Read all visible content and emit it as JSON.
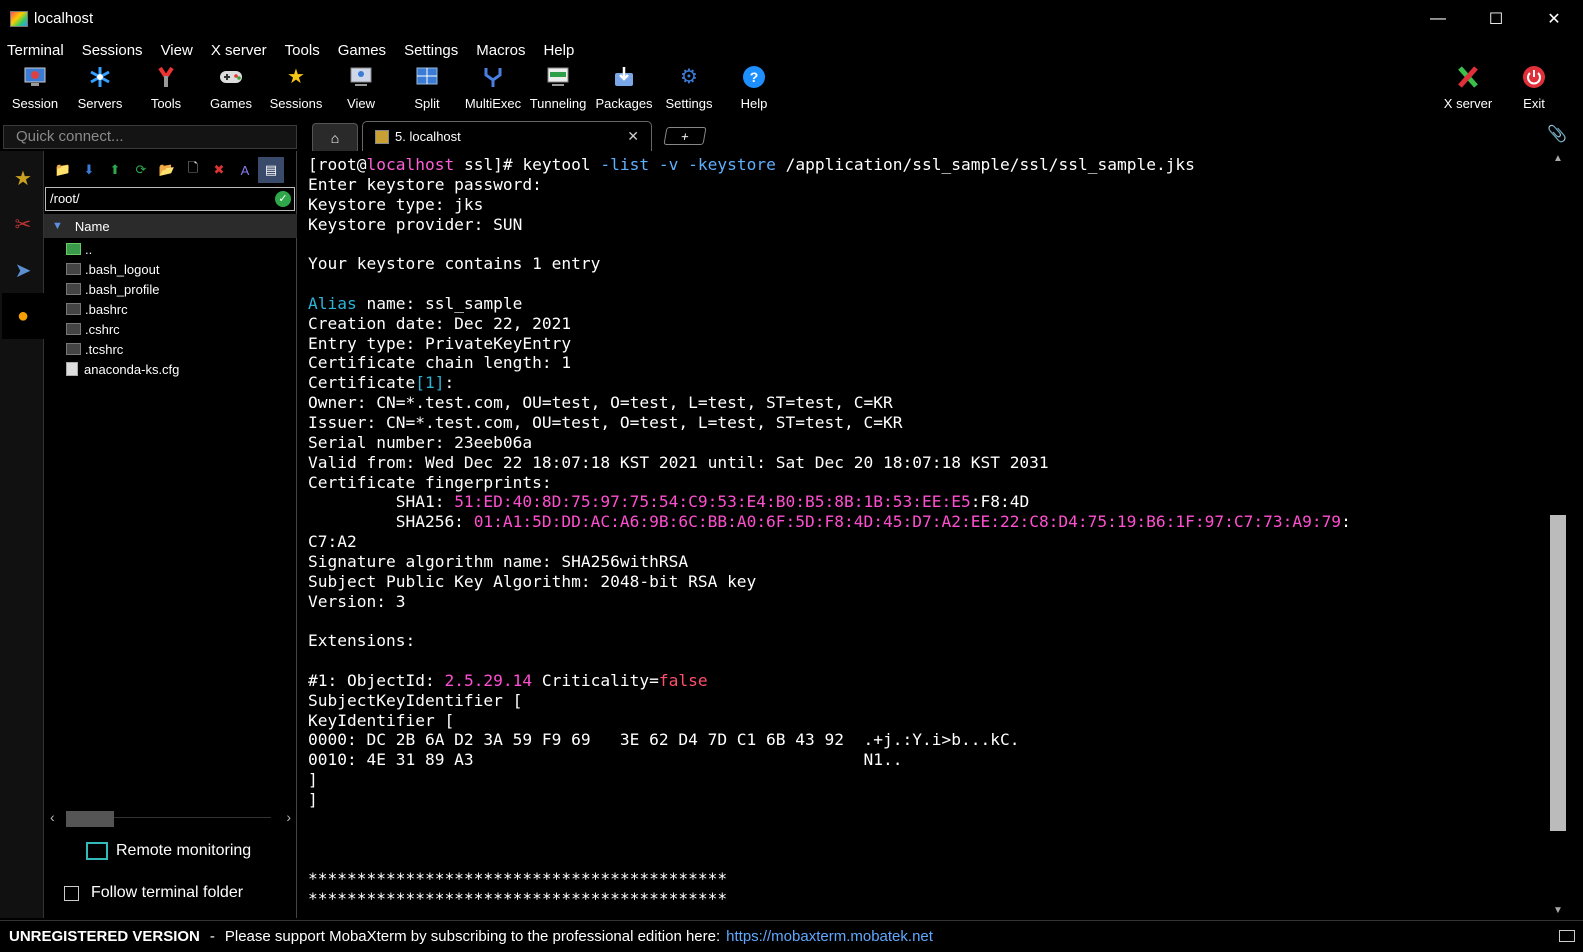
{
  "window": {
    "title": "localhost",
    "minimize": "—",
    "maximize": "☐",
    "close": "✕"
  },
  "menu": [
    "Terminal",
    "Sessions",
    "View",
    "X server",
    "Tools",
    "Games",
    "Settings",
    "Macros",
    "Help"
  ],
  "toolbar": {
    "session": "Session",
    "servers": "Servers",
    "tools": "Tools",
    "games": "Games",
    "sessions": "Sessions",
    "view": "View",
    "split": "Split",
    "multiexec": "MultiExec",
    "tunneling": "Tunneling",
    "packages": "Packages",
    "settings": "Settings",
    "help": "Help",
    "xserver": "X server",
    "exit": "Exit"
  },
  "quick_connect": {
    "placeholder": "Quick connect..."
  },
  "tabs": {
    "active_label": "5. localhost",
    "close": "✕",
    "add": "+"
  },
  "sidebar": {
    "path": "/root/",
    "column_header": "Name",
    "files": [
      "..",
      ".bash_logout",
      ".bash_profile",
      ".bashrc",
      ".cshrc",
      ".tcshrc",
      "anaconda-ks.cfg"
    ],
    "remote_monitoring": "Remote monitoring",
    "follow_terminal_folder": "Follow terminal folder"
  },
  "terminal": {
    "prompt_open": "[root@",
    "prompt_host": "localhost",
    "prompt_close": " ssl]# ",
    "cmd_keytool": "keytool ",
    "cmd_opt_list": "-list",
    "cmd_sp1": " ",
    "cmd_opt_v": "-v",
    "cmd_sp2": " ",
    "cmd_opt_keystore": "-keystore",
    "cmd_path": " /application/ssl_sample/ssl/ssl_sample.jks",
    "l_enter_pw": "Enter keystore password:",
    "l_ks_type": "Keystore type: jks",
    "l_ks_provider": "Keystore provider: SUN",
    "l_contains": "Your keystore contains 1 entry",
    "alias_word": "Alias",
    "alias_rest": " name: ssl_sample",
    "l_creation": "Creation date: Dec 22, 2021",
    "l_entry_type": "Entry type: PrivateKeyEntry",
    "l_chain": "Certificate chain length: 1",
    "cert_word": "Certificate",
    "cert_idx": "[1]",
    "cert_colon": ":",
    "l_owner": "Owner: CN=*.test.com, OU=test, O=test, L=test, ST=test, C=KR",
    "l_issuer": "Issuer: CN=*.test.com, OU=test, O=test, L=test, ST=test, C=KR",
    "l_serial": "Serial number: 23eeb06a",
    "l_valid": "Valid from: Wed Dec 22 18:07:18 KST 2021 until: Sat Dec 20 18:07:18 KST 2031",
    "l_fingerprints": "Certificate fingerprints:",
    "sha1_label": "         SHA1: ",
    "sha1_colored": "51:ED:40:8D:75:97:75:54:C9:53:E4:B0:B5:8B:1B:53:EE:E5",
    "sha1_tail": ":F8:4D",
    "sha256_label": "         SHA256: ",
    "sha256_colored": "01:A1:5D:DD:AC:A6:9B:6C:BB:A0:6F:5D:F8:4D:45:D7:A2:EE:22:C8:D4:75:19:B6:1F:97:C7:73:A9:79",
    "sha256_colon": ":",
    "l_sha256_wrap": "C7:A2",
    "l_sig_alg": "Signature algorithm name: SHA256withRSA",
    "l_pubkey": "Subject Public Key Algorithm: 2048-bit RSA key",
    "l_version": "Version: 3",
    "l_extensions": "Extensions:",
    "ext_prefix": "#1: ObjectId: ",
    "ext_oid": "2.5.29.14",
    "ext_mid": " Criticality=",
    "ext_crit": "false",
    "l_ski": "SubjectKeyIdentifier [",
    "l_keyid": "KeyIdentifier [",
    "l_hex0": "0000: DC 2B 6A D2 3A 59 F9 69   3E 62 D4 7D C1 6B 43 92  .+j.:Y.i>b...kC.",
    "l_hex1": "0010: 4E 31 89 A3                                        N1..",
    "l_br1": "]",
    "l_br2": "]",
    "l_stars1": "*******************************************",
    "l_stars2": "*******************************************"
  },
  "status": {
    "unregistered": "UNREGISTERED VERSION",
    "separator": "-",
    "message": "Please support MobaXterm by subscribing to the professional edition here:",
    "link": "https://mobaxterm.mobatek.net"
  },
  "colors": {
    "prompt_host": "#ff5fd7",
    "keytool_options": "#5fafff",
    "alias_highlight": "#2fb3d6",
    "fingerprint": "#ff4fd0",
    "false_value": "#ff4f6a",
    "link": "#5fa8ff"
  }
}
